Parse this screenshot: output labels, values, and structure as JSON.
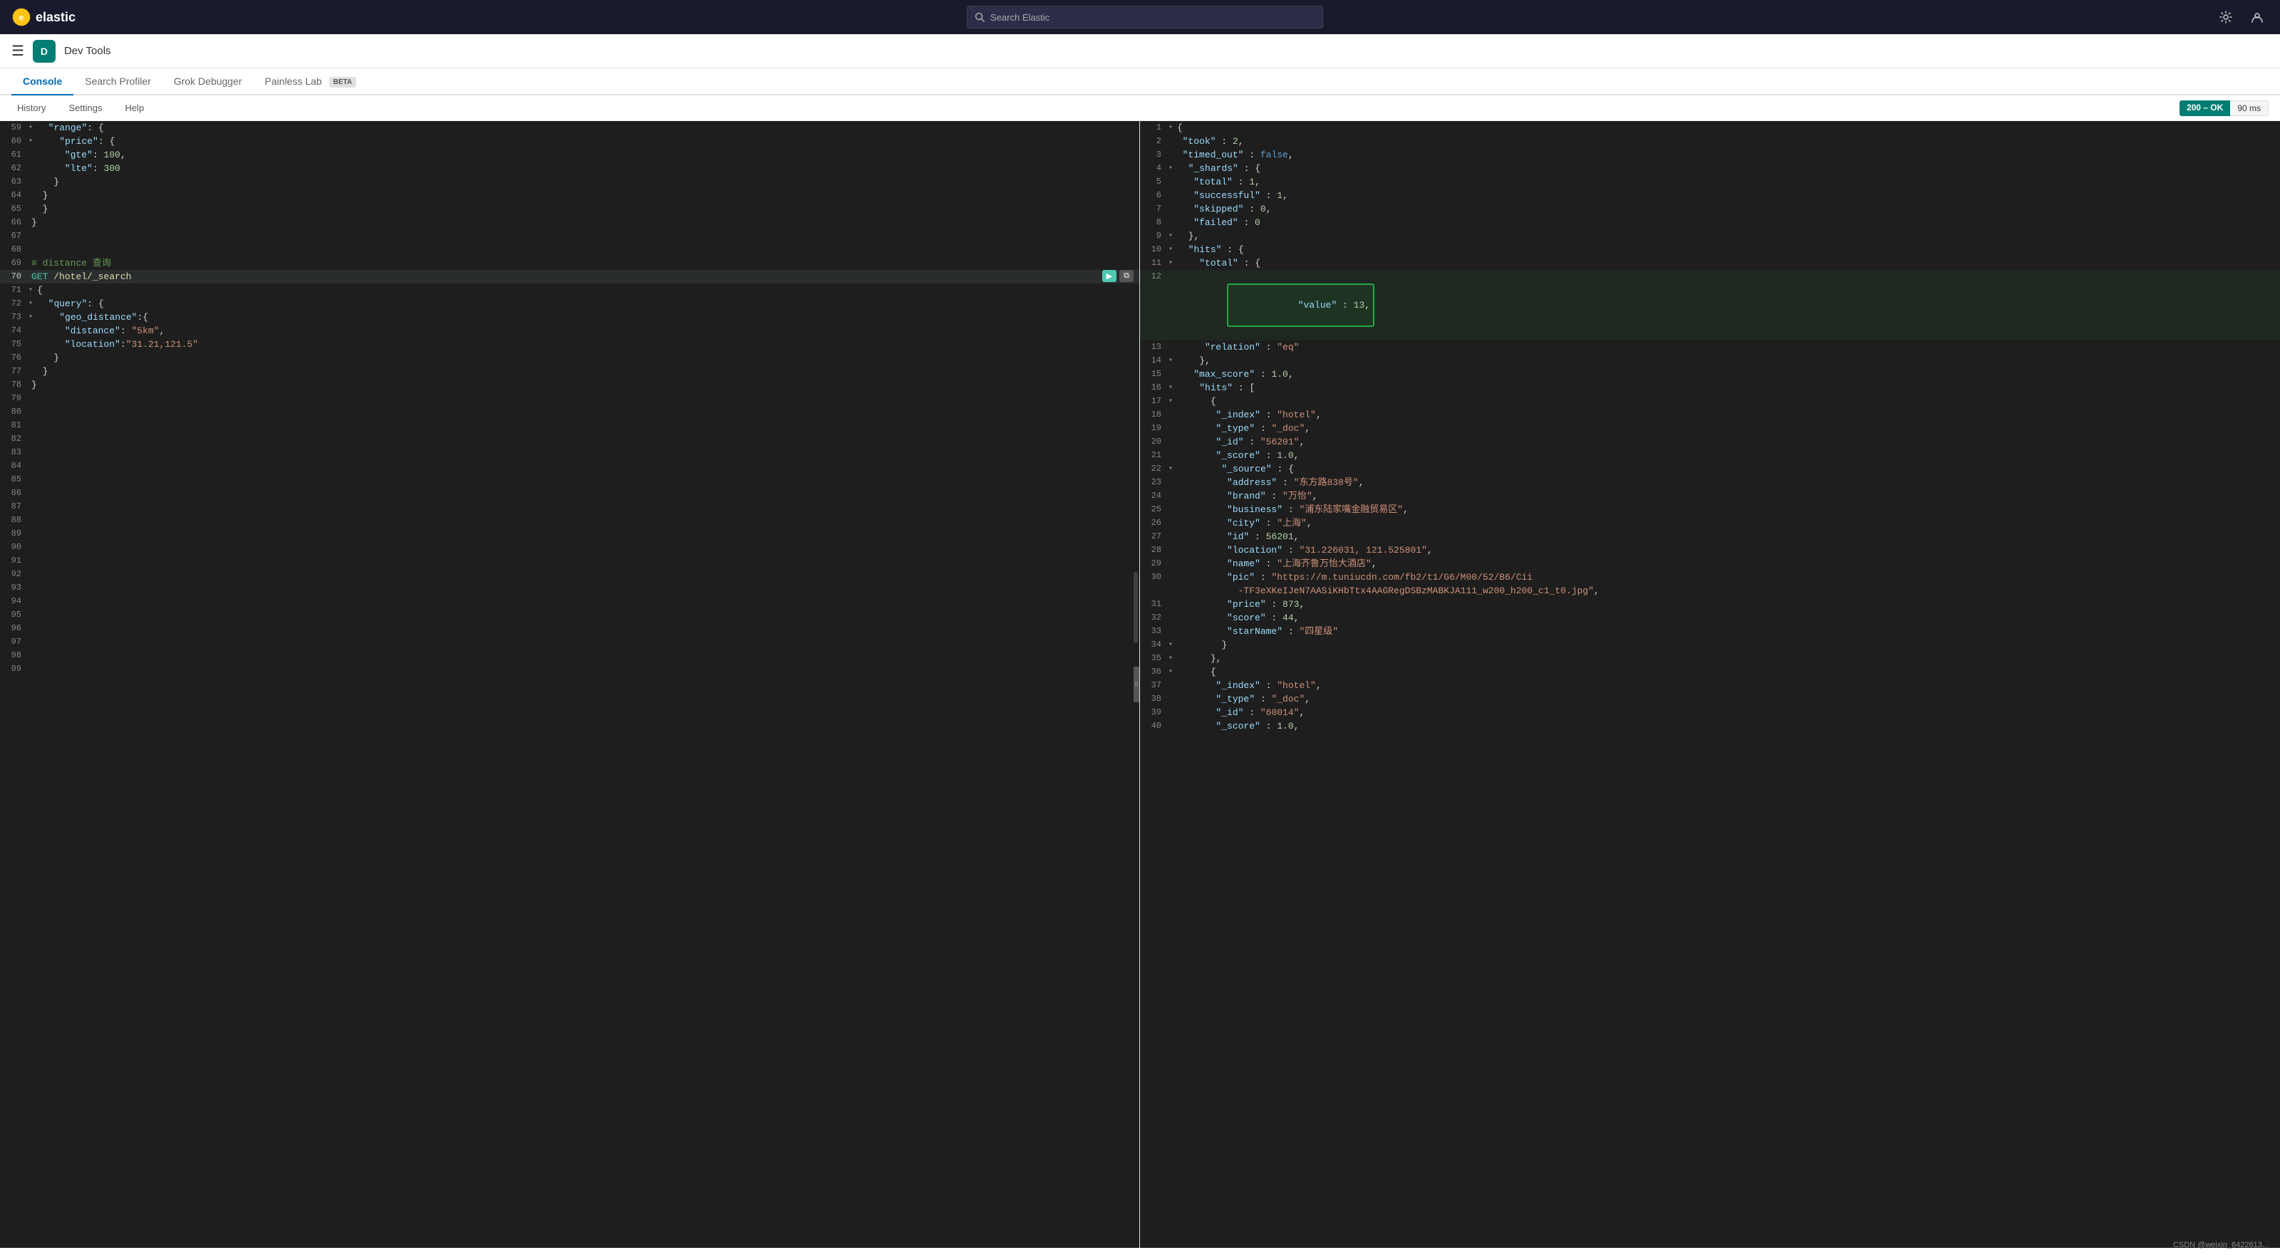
{
  "app": {
    "logo_text": "elastic",
    "nav_icon_1": "⚙",
    "nav_icon_2": "👤"
  },
  "search": {
    "placeholder": "Search Elastic"
  },
  "devtools": {
    "badge": "D",
    "title": "Dev Tools"
  },
  "tabs": [
    {
      "id": "console",
      "label": "Console",
      "active": true,
      "beta": false
    },
    {
      "id": "search-profiler",
      "label": "Search Profiler",
      "active": false,
      "beta": false
    },
    {
      "id": "grok-debugger",
      "label": "Grok Debugger",
      "active": false,
      "beta": false
    },
    {
      "id": "painless-lab",
      "label": "Painless Lab",
      "active": false,
      "beta": true
    }
  ],
  "toolbar": {
    "history": "History",
    "settings": "Settings",
    "help": "Help",
    "status": "200 – OK",
    "time": "90 ms"
  },
  "left_editor": {
    "lines": [
      {
        "num": 59,
        "content": "  \"range\": {",
        "indent": 2
      },
      {
        "num": 60,
        "content": "    \"price\": {",
        "indent": 4
      },
      {
        "num": 61,
        "content": "      \"gte\": 100,",
        "indent": 6
      },
      {
        "num": 62,
        "content": "      \"lte\": 300",
        "indent": 6
      },
      {
        "num": 63,
        "content": "    }",
        "indent": 4
      },
      {
        "num": 64,
        "content": "  }",
        "indent": 2
      },
      {
        "num": 65,
        "content": "}",
        "indent": 0
      },
      {
        "num": 66,
        "content": "}",
        "indent": 0
      },
      {
        "num": 67,
        "content": "",
        "indent": 0
      },
      {
        "num": 68,
        "content": "",
        "indent": 0
      },
      {
        "num": 69,
        "content": "# distance 查询",
        "indent": 0
      },
      {
        "num": 70,
        "content": "GET /hotel/_search",
        "indent": 0,
        "active": true
      },
      {
        "num": 71,
        "content": "{",
        "indent": 0
      },
      {
        "num": 72,
        "content": "  \"query\": {",
        "indent": 2
      },
      {
        "num": 73,
        "content": "    \"geo_distance\":{",
        "indent": 4
      },
      {
        "num": 74,
        "content": "      \"distance\": \"5km\",",
        "indent": 6
      },
      {
        "num": 75,
        "content": "      \"location\":\"31.21,121.5\"",
        "indent": 6
      },
      {
        "num": 76,
        "content": "    }",
        "indent": 4
      },
      {
        "num": 77,
        "content": "  }",
        "indent": 2
      },
      {
        "num": 78,
        "content": "}",
        "indent": 0
      },
      {
        "num": 79,
        "content": "",
        "indent": 0
      },
      {
        "num": 80,
        "content": "",
        "indent": 0
      },
      {
        "num": 81,
        "content": "",
        "indent": 0
      },
      {
        "num": 82,
        "content": "",
        "indent": 0
      },
      {
        "num": 83,
        "content": "",
        "indent": 0
      },
      {
        "num": 84,
        "content": "",
        "indent": 0
      },
      {
        "num": 85,
        "content": "",
        "indent": 0
      },
      {
        "num": 86,
        "content": "",
        "indent": 0
      },
      {
        "num": 87,
        "content": "",
        "indent": 0
      },
      {
        "num": 88,
        "content": "",
        "indent": 0
      },
      {
        "num": 89,
        "content": "",
        "indent": 0
      },
      {
        "num": 90,
        "content": "",
        "indent": 0
      },
      {
        "num": 91,
        "content": "",
        "indent": 0
      },
      {
        "num": 92,
        "content": "",
        "indent": 0
      },
      {
        "num": 93,
        "content": "",
        "indent": 0
      },
      {
        "num": 94,
        "content": "",
        "indent": 0
      },
      {
        "num": 95,
        "content": "",
        "indent": 0
      },
      {
        "num": 96,
        "content": "",
        "indent": 0
      },
      {
        "num": 97,
        "content": "",
        "indent": 0
      },
      {
        "num": 98,
        "content": "",
        "indent": 0
      },
      {
        "num": 99,
        "content": "",
        "indent": 0
      }
    ]
  },
  "right_output": {
    "lines": [
      {
        "num": 1,
        "content": "{"
      },
      {
        "num": 2,
        "content": "  \"took\" : 2,"
      },
      {
        "num": 3,
        "content": "  \"timed_out\" : false,"
      },
      {
        "num": 4,
        "content": "  \"_shards\" : {"
      },
      {
        "num": 5,
        "content": "    \"total\" : 1,"
      },
      {
        "num": 6,
        "content": "    \"successful\" : 1,"
      },
      {
        "num": 7,
        "content": "    \"skipped\" : 0,"
      },
      {
        "num": 8,
        "content": "    \"failed\" : 0"
      },
      {
        "num": 9,
        "content": "  },"
      },
      {
        "num": 10,
        "content": "  \"hits\" : {"
      },
      {
        "num": 11,
        "content": "    \"total\" : {"
      },
      {
        "num": 12,
        "content": "      \"value\" : 13,",
        "highlighted": true
      },
      {
        "num": 13,
        "content": "      \"relation\" : \"eq\""
      },
      {
        "num": 14,
        "content": "    },"
      },
      {
        "num": 15,
        "content": "    \"max_score\" : 1.0,"
      },
      {
        "num": 16,
        "content": "    \"hits\" : ["
      },
      {
        "num": 17,
        "content": "      {"
      },
      {
        "num": 18,
        "content": "        \"_index\" : \"hotel\","
      },
      {
        "num": 19,
        "content": "        \"_type\" : \"_doc\","
      },
      {
        "num": 20,
        "content": "        \"_id\" : \"56201\","
      },
      {
        "num": 21,
        "content": "        \"_score\" : 1.0,"
      },
      {
        "num": 22,
        "content": "        \"_source\" : {"
      },
      {
        "num": 23,
        "content": "          \"address\" : \"东方路838号\","
      },
      {
        "num": 24,
        "content": "          \"brand\" : \"万怡\","
      },
      {
        "num": 25,
        "content": "          \"business\" : \"浦东陆家嘴金融贸易区\","
      },
      {
        "num": 26,
        "content": "          \"city\" : \"上海\","
      },
      {
        "num": 27,
        "content": "          \"id\" : 56201,"
      },
      {
        "num": 28,
        "content": "          \"location\" : \"31.226031, 121.525801\","
      },
      {
        "num": 29,
        "content": "          \"name\" : \"上海齐鲁万怡大酒店\","
      },
      {
        "num": 30,
        "content": "          \"pic\" : \"https://m.tuniucdn.com/fb2/t1/G6/M00/52/B6/Cii"
      },
      {
        "num": 31,
        "content": "            -TF3eXKeIJeN7AASiKHbTtx4AAGRegDSBzMABKJA111_w200_h200_c1_t0.jpg\","
      },
      {
        "num": 31,
        "content": "          \"price\" : 873,"
      },
      {
        "num": 32,
        "content": "          \"score\" : 44,"
      },
      {
        "num": 33,
        "content": "          \"starName\" : \"四星级\""
      },
      {
        "num": 34,
        "content": "        }"
      },
      {
        "num": 35,
        "content": "      },"
      },
      {
        "num": 36,
        "content": "      {"
      },
      {
        "num": 37,
        "content": "        \"_index\" : \"hotel\","
      },
      {
        "num": 38,
        "content": "        \"_type\" : \"_doc\","
      },
      {
        "num": 39,
        "content": "        \"_id\" : \"60014\","
      },
      {
        "num": 40,
        "content": "        \"_score\" : 1.0,"
      }
    ]
  },
  "watermark": "CSDN @weixin_6422613..."
}
